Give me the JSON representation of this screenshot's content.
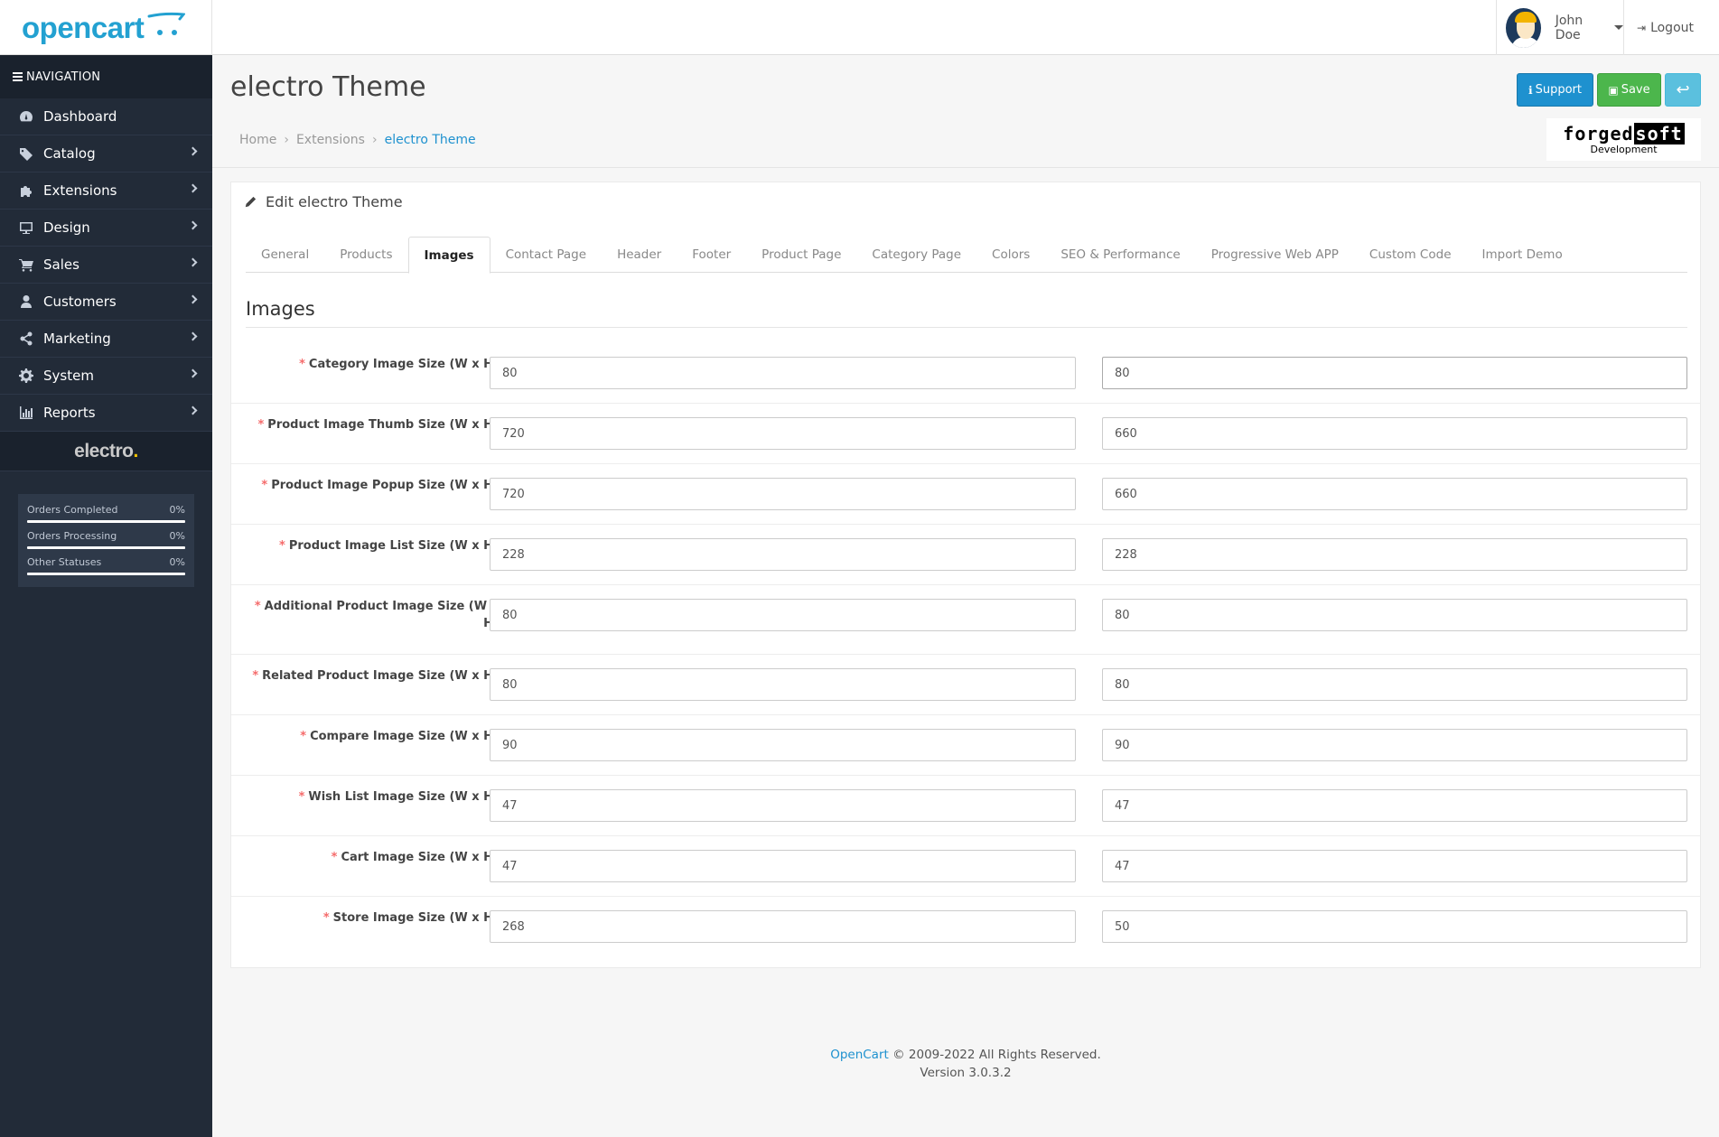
{
  "header": {
    "logo_text": "opencart",
    "user_name": "John Doe",
    "logout_label": "Logout"
  },
  "sidebar": {
    "nav_title": "NAVIGATION",
    "items": [
      {
        "label": "Dashboard",
        "icon": "dashboard-icon",
        "has_children": false
      },
      {
        "label": "Catalog",
        "icon": "tags-icon",
        "has_children": true
      },
      {
        "label": "Extensions",
        "icon": "puzzle-icon",
        "has_children": true
      },
      {
        "label": "Design",
        "icon": "monitor-icon",
        "has_children": true
      },
      {
        "label": "Sales",
        "icon": "cart-icon",
        "has_children": true
      },
      {
        "label": "Customers",
        "icon": "user-icon",
        "has_children": true
      },
      {
        "label": "Marketing",
        "icon": "share-icon",
        "has_children": true
      },
      {
        "label": "System",
        "icon": "gear-icon",
        "has_children": true
      },
      {
        "label": "Reports",
        "icon": "bar-chart-icon",
        "has_children": true
      }
    ],
    "brand": "electro",
    "stats": [
      {
        "label": "Orders Completed",
        "value": "0%"
      },
      {
        "label": "Orders Processing",
        "value": "0%"
      },
      {
        "label": "Other Statuses",
        "value": "0%"
      }
    ]
  },
  "page": {
    "title": "electro Theme",
    "breadcrumb": [
      "Home",
      "Extensions",
      "electro Theme"
    ],
    "buttons": {
      "support": "Support",
      "save": "Save"
    },
    "partner_logo": {
      "main_a": "forged",
      "main_b": "soft",
      "sub": "Development"
    }
  },
  "panel": {
    "heading": "Edit electro Theme",
    "tabs": [
      "General",
      "Products",
      "Images",
      "Contact Page",
      "Header",
      "Footer",
      "Product Page",
      "Category Page",
      "Colors",
      "SEO & Performance",
      "Progressive Web APP",
      "Custom Code",
      "Import Demo"
    ],
    "active_tab": "Images",
    "section_title": "Images",
    "fields": [
      {
        "label": "Category Image Size (W x H)",
        "width": "80",
        "height": "80"
      },
      {
        "label": "Product Image Thumb Size (W x H)",
        "width": "720",
        "height": "660"
      },
      {
        "label": "Product Image Popup Size (W x H)",
        "width": "720",
        "height": "660"
      },
      {
        "label": "Product Image List Size (W x H)",
        "width": "228",
        "height": "228"
      },
      {
        "label": "Additional Product Image Size (W x H)",
        "width": "80",
        "height": "80"
      },
      {
        "label": "Related Product Image Size (W x H)",
        "width": "80",
        "height": "80"
      },
      {
        "label": "Compare Image Size (W x H)",
        "width": "90",
        "height": "90"
      },
      {
        "label": "Wish List Image Size (W x H)",
        "width": "47",
        "height": "47"
      },
      {
        "label": "Cart Image Size (W x H)",
        "width": "47",
        "height": "47"
      },
      {
        "label": "Store Image Size (W x H)",
        "width": "268",
        "height": "50"
      }
    ]
  },
  "footer": {
    "link": "OpenCart",
    "copyright": " © 2009-2022 All Rights Reserved.",
    "version": "Version 3.0.3.2"
  }
}
